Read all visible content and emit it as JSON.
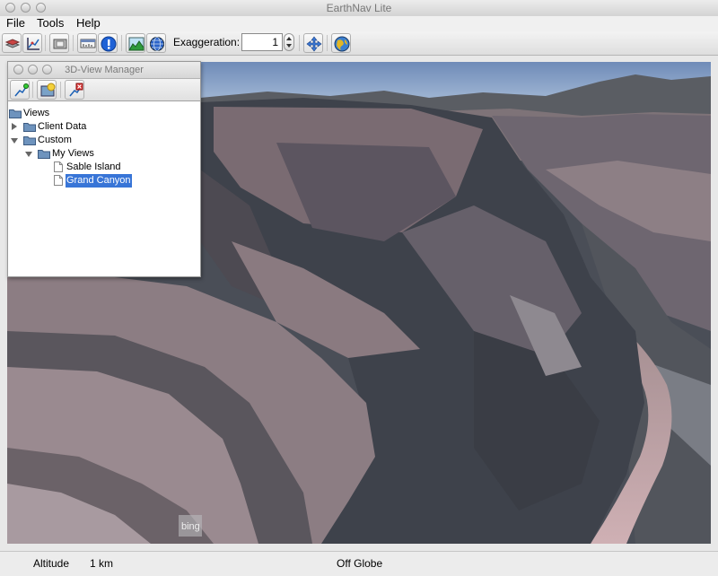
{
  "window": {
    "title": "EarthNav Lite"
  },
  "menubar": {
    "items": [
      {
        "label": "File"
      },
      {
        "label": "Tools"
      },
      {
        "label": "Help"
      }
    ]
  },
  "toolbar": {
    "exaggeration_label": "Exaggeration:",
    "exaggeration_value": "1",
    "buttons": [
      "layers-icon",
      "graph-icon",
      "screenshot-icon",
      "ruler-icon",
      "info-icon",
      "terrain-icon",
      "globe-icon",
      "pan-icon",
      "earth-icon"
    ]
  },
  "view_manager": {
    "title": "3D-View Manager",
    "tree": {
      "root": "Views",
      "client_data": "Client Data",
      "custom": "Custom",
      "my_views": "My Views",
      "items": [
        {
          "label": "Sable Island"
        },
        {
          "label": "Grand Canyon",
          "selected": true
        }
      ]
    }
  },
  "viewport": {
    "watermark": "bing"
  },
  "status": {
    "altitude_label": "Altitude",
    "altitude_value": "1 km",
    "location": "Off Globe"
  }
}
